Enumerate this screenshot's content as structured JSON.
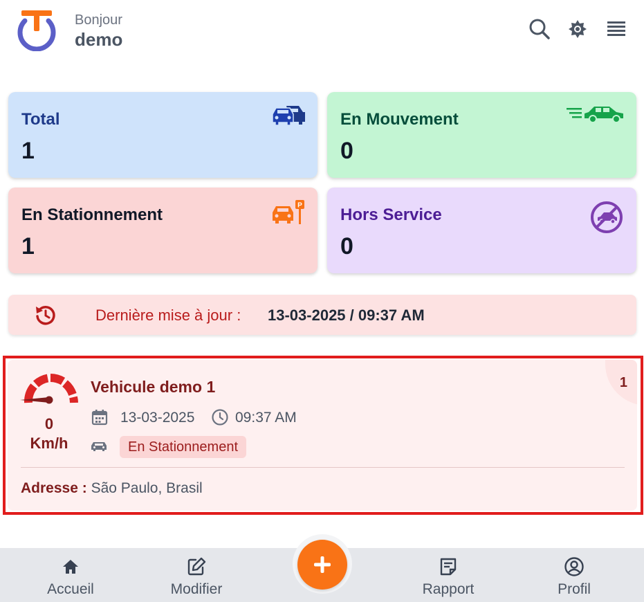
{
  "header": {
    "greeting": "Bonjour",
    "username": "demo",
    "icons": [
      "search-icon",
      "brightness-icon",
      "menu-icon"
    ]
  },
  "stats": {
    "total": {
      "label": "Total",
      "value": "1",
      "bg": "#cfe3fb",
      "color": "#1e3a8a",
      "icon": "cars-icon"
    },
    "moving": {
      "label": "En Mouvement",
      "value": "0",
      "bg": "#c3f5d3",
      "color": "#064e3b",
      "icon": "moving-car-icon"
    },
    "parked": {
      "label": "En Stationnement",
      "value": "1",
      "bg": "#fbd5d5",
      "color": "#111827",
      "icon": "parked-car-icon"
    },
    "offline": {
      "label": "Hors Service",
      "value": "0",
      "bg": "#e9dafc",
      "color": "#4c1d95",
      "icon": "no-car-icon"
    }
  },
  "update": {
    "label": "Dernière mise à jour :",
    "value": "13-03-2025 / 09:37 AM"
  },
  "vehicle": {
    "name": "Vehicule demo 1",
    "speed": "0",
    "speed_unit": "Km/h",
    "date": "13-03-2025",
    "time": "09:37 AM",
    "status": "En Stationnement",
    "address_label": "Adresse :",
    "address": "São Paulo, Brasil",
    "index": "1"
  },
  "nav": {
    "home": "Accueil",
    "edit": "Modifier",
    "report": "Rapport",
    "profile": "Profil",
    "fab": "+"
  },
  "colors": {
    "accent": "#f97316",
    "brand_blue": "#5b5fc7",
    "alert_red": "#e11d1d"
  }
}
